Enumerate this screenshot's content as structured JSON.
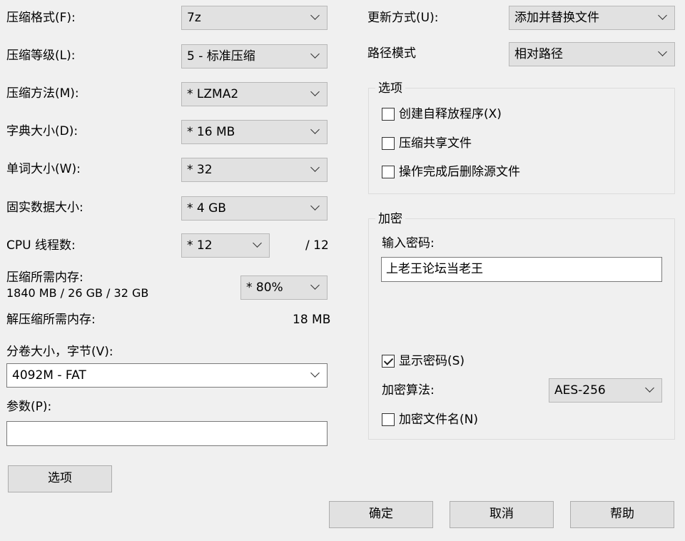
{
  "left": {
    "format": {
      "label": "压缩格式(F):",
      "value": "7z"
    },
    "level": {
      "label": "压缩等级(L):",
      "value": "5 - 标准压缩"
    },
    "method": {
      "label": "压缩方法(M):",
      "value": "* LZMA2"
    },
    "dict": {
      "label": "字典大小(D):",
      "value": "* 16 MB"
    },
    "word": {
      "label": "单词大小(W):",
      "value": "* 32"
    },
    "solid": {
      "label": "固实数据大小:",
      "value": "* 4 GB"
    },
    "cpu": {
      "label": "CPU 线程数:",
      "value": "* 12",
      "total": "/ 12"
    },
    "mem_compress": {
      "label": "压缩所需内存:",
      "detail": "1840 MB / 26 GB / 32 GB",
      "percent": "* 80%"
    },
    "mem_decompress": {
      "label": "解压缩所需内存:",
      "value": "18 MB"
    },
    "volume": {
      "label": "分卷大小，字节(V):",
      "value": "4092M - FAT"
    },
    "params": {
      "label": "参数(P):",
      "value": ""
    },
    "options_button": "选项"
  },
  "right": {
    "update": {
      "label": "更新方式(U):",
      "value": "添加并替换文件"
    },
    "path": {
      "label": "路径模式",
      "value": "相对路径"
    },
    "options_group": {
      "title": "选项",
      "items": [
        {
          "label": "创建自释放程序(X)",
          "checked": false
        },
        {
          "label": "压缩共享文件",
          "checked": false
        },
        {
          "label": "操作完成后删除源文件",
          "checked": false
        }
      ]
    },
    "encrypt_group": {
      "title": "加密",
      "password_label": "输入密码:",
      "password_value": "上老王论坛当老王",
      "show_password": {
        "label": "显示密码(S)",
        "checked": true
      },
      "method_label": "加密算法:",
      "method_value": "AES-256",
      "encrypt_names": {
        "label": "加密文件名(N)",
        "checked": false
      }
    }
  },
  "footer": {
    "ok": "确定",
    "cancel": "取消",
    "help": "帮助"
  }
}
